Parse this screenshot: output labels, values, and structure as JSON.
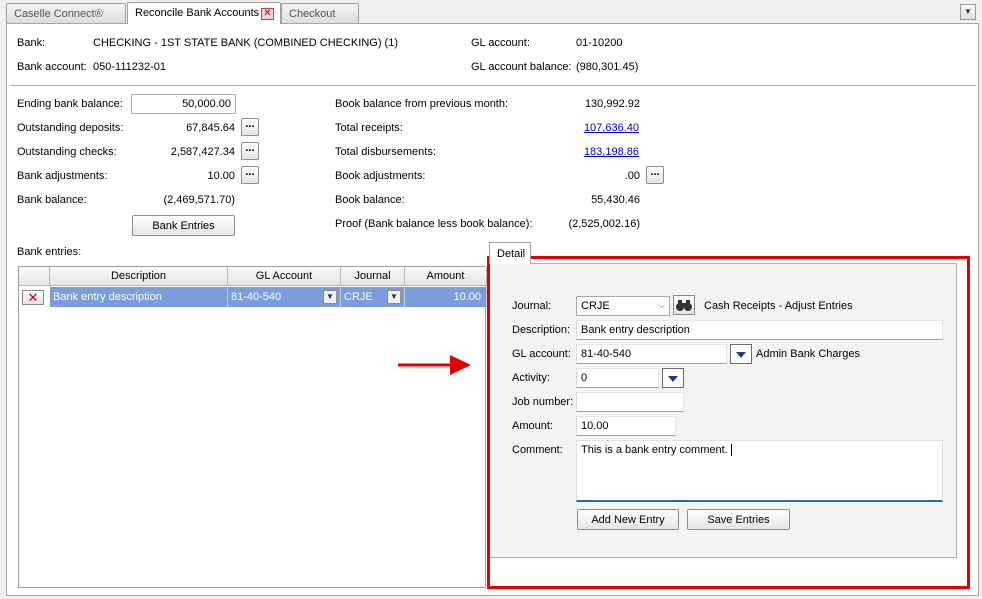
{
  "tabs": [
    {
      "label": "Caselle Connect®"
    },
    {
      "label": "Reconcile Bank Accounts"
    },
    {
      "label": "Checkout"
    }
  ],
  "header": {
    "bank_label": "Bank:",
    "bank_value": "CHECKING - 1ST STATE BANK (COMBINED CHECKING) (1)",
    "bank_account_label": "Bank account:",
    "bank_account_value": "050-111232-01",
    "gl_account_label": "GL account:",
    "gl_account_value": "01-10200",
    "gl_balance_label": "GL account balance:",
    "gl_balance_value": "(980,301.45)"
  },
  "left_summary": {
    "ending_balance_label": "Ending bank balance:",
    "ending_balance_value": "50,000.00",
    "outstanding_deposits_label": "Outstanding deposits:",
    "outstanding_deposits_value": "67,845.64",
    "outstanding_checks_label": "Outstanding checks:",
    "outstanding_checks_value": "2,587,427.34",
    "bank_adjustments_label": "Bank adjustments:",
    "bank_adjustments_value": "10.00",
    "bank_balance_label": "Bank balance:",
    "bank_balance_value": "(2,469,571.70)",
    "bank_entries_button": "Bank Entries",
    "ellipsis": "..."
  },
  "right_summary": {
    "book_prev_label": "Book balance from previous month:",
    "book_prev_value": "130,992.92",
    "total_receipts_label": "Total receipts:",
    "total_receipts_value": "107,636.40",
    "total_disbursements_label": "Total disbursements:",
    "total_disbursements_value": "183,198.86",
    "book_adjustments_label": "Book adjustments:",
    "book_adjustments_value": ".00",
    "book_balance_label": "Book balance:",
    "book_balance_value": "55,430.46",
    "proof_label": "Proof (Bank balance less book balance):",
    "proof_value": "(2,525,002.16)"
  },
  "bank_entries": {
    "label": "Bank entries:",
    "columns": [
      "Description",
      "GL Account",
      "Journal",
      "Amount"
    ],
    "rows": [
      {
        "description": "Bank entry description",
        "gl_account": "81-40-540",
        "journal": "CRJE",
        "amount": "10.00"
      }
    ]
  },
  "detail": {
    "tab_label": "Detail",
    "journal_label": "Journal:",
    "journal_value": "CRJE",
    "journal_desc": "Cash Receipts - Adjust Entries",
    "description_label": "Description:",
    "description_value": "Bank entry description",
    "gl_account_label": "GL account:",
    "gl_account_value": "81-40-540",
    "gl_account_desc": "Admin Bank Charges",
    "activity_label": "Activity:",
    "activity_value": "0",
    "job_number_label": "Job number:",
    "job_number_value": "",
    "amount_label": "Amount:",
    "amount_value": "10.00",
    "comment_label": "Comment:",
    "comment_value": "This is a bank entry comment.",
    "add_new_entry_button": "Add New Entry",
    "save_entries_button": "Save Entries"
  },
  "colors": {
    "highlight_border": "#e00000",
    "arrow": "#e00000",
    "selected_row": "#7b9ddb",
    "link": "#0000cc"
  }
}
